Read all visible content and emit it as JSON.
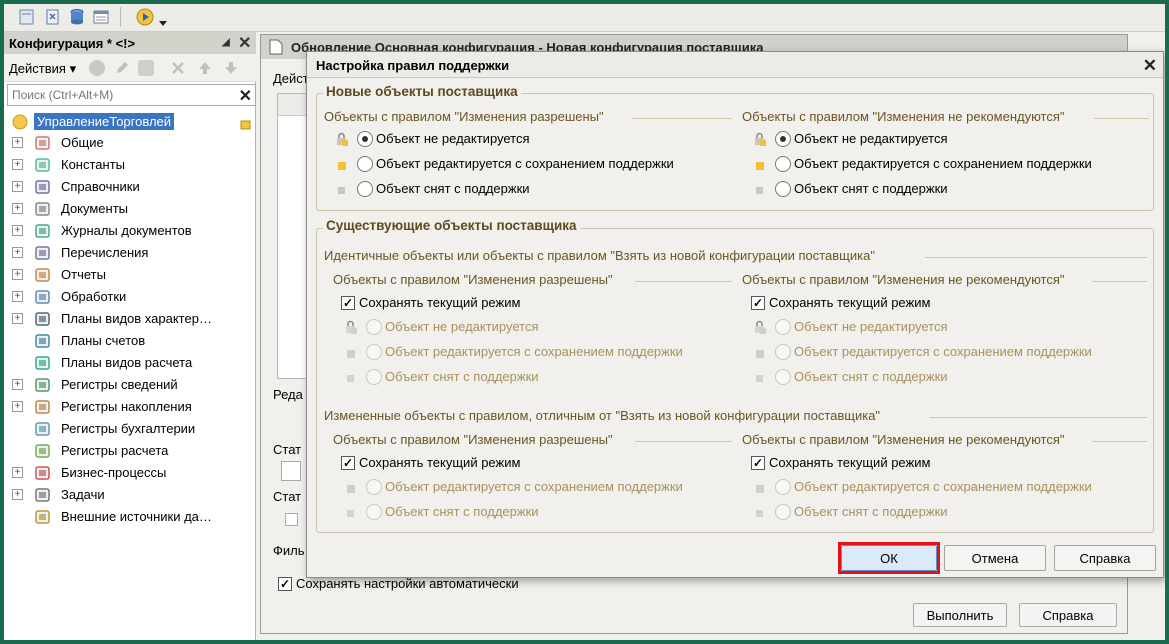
{
  "config_panel": {
    "title": "Конфигурация * <!>",
    "pin_icon": "pin-icon",
    "close_icon": "close-icon",
    "actions_label": "Действия",
    "search_placeholder": "Поиск (Ctrl+Alt+M)",
    "tree": {
      "root": "УправлениеТорговлей",
      "items": [
        {
          "label": "Общие",
          "icon": "common-icon",
          "expand": true
        },
        {
          "label": "Константы",
          "icon": "constants-icon",
          "expand": true
        },
        {
          "label": "Справочники",
          "icon": "catalogs-icon",
          "expand": true
        },
        {
          "label": "Документы",
          "icon": "documents-icon",
          "expand": true
        },
        {
          "label": "Журналы документов",
          "icon": "journals-icon",
          "expand": true
        },
        {
          "label": "Перечисления",
          "icon": "enums-icon",
          "expand": true
        },
        {
          "label": "Отчеты",
          "icon": "reports-icon",
          "expand": true
        },
        {
          "label": "Обработки",
          "icon": "processing-icon",
          "expand": true
        },
        {
          "label": "Планы видов характер…",
          "icon": "chart-types-icon",
          "expand": true
        },
        {
          "label": "Планы счетов",
          "icon": "accounts-icon",
          "expand": false
        },
        {
          "label": "Планы видов расчета",
          "icon": "calc-types-icon",
          "expand": false
        },
        {
          "label": "Регистры сведений",
          "icon": "info-registers-icon",
          "expand": true
        },
        {
          "label": "Регистры накопления",
          "icon": "accum-registers-icon",
          "expand": true
        },
        {
          "label": "Регистры бухгалтерии",
          "icon": "accounting-registers-icon",
          "expand": false
        },
        {
          "label": "Регистры расчета",
          "icon": "calc-registers-icon",
          "expand": false
        },
        {
          "label": "Бизнес-процессы",
          "icon": "business-process-icon",
          "expand": true
        },
        {
          "label": "Задачи",
          "icon": "tasks-icon",
          "expand": true
        },
        {
          "label": "Внешние источники да…",
          "icon": "external-sources-icon",
          "expand": false
        }
      ]
    }
  },
  "background_window": {
    "title": "Обновление Основная конфигурация - Новая конфигурация поставщика",
    "actions_partial": "Дейст",
    "label_reda": "Реда",
    "label_stat1": "Стат",
    "label_stat2": "Стат",
    "label_filt": "Филь",
    "autosave_label": "Сохранять настройки автоматически",
    "execute_button": "Выполнить",
    "help_button": "Справка"
  },
  "dialog": {
    "title": "Настройка правил поддержки",
    "new_objects": {
      "title": "Новые объекты поставщика",
      "left": {
        "caption": "Объекты с правилом \"Изменения разрешены\"",
        "options": [
          "Объект не редактируется",
          "Объект редактируется с сохранением поддержки",
          "Объект снят с поддержки"
        ],
        "selected": 0
      },
      "right": {
        "caption": "Объекты с правилом \"Изменения не рекомендуются\"",
        "options": [
          "Объект не редактируется",
          "Объект редактируется с сохранением поддержки",
          "Объект снят с поддержки"
        ],
        "selected": 0
      }
    },
    "existing_objects": {
      "title": "Существующие объекты поставщика",
      "identical": {
        "caption": "Идентичные объекты или объекты с правилом \"Взять из новой конфигурации поставщика\"",
        "left": {
          "caption": "Объекты с правилом \"Изменения разрешены\"",
          "keep_label": "Сохранять текущий режим",
          "keep_checked": true,
          "options": [
            "Объект не редактируется",
            "Объект редактируется с сохранением поддержки",
            "Объект снят с поддержки"
          ]
        },
        "right": {
          "caption": "Объекты с правилом \"Изменения не рекомендуются\"",
          "keep_label": "Сохранять текущий режим",
          "keep_checked": true,
          "options": [
            "Объект не редактируется",
            "Объект редактируется с сохранением поддержки",
            "Объект снят с поддержки"
          ]
        }
      },
      "changed": {
        "caption": "Измененные объекты с правилом, отличным от \"Взять из новой конфигурации поставщика\"",
        "left": {
          "caption": "Объекты с правилом \"Изменения разрешены\"",
          "keep_label": "Сохранять текущий режим",
          "keep_checked": true,
          "options": [
            "Объект редактируется с сохранением поддержки",
            "Объект снят с поддержки"
          ]
        },
        "right": {
          "caption": "Объекты с правилом \"Изменения не рекомендуются\"",
          "keep_label": "Сохранять текущий режим",
          "keep_checked": true,
          "options": [
            "Объект редактируется с сохранением поддержки",
            "Объект снят с поддержки"
          ]
        }
      }
    },
    "buttons": {
      "ok": "ОК",
      "cancel": "Отмена",
      "help": "Справка"
    },
    "highlight_color": "#e0131a"
  }
}
